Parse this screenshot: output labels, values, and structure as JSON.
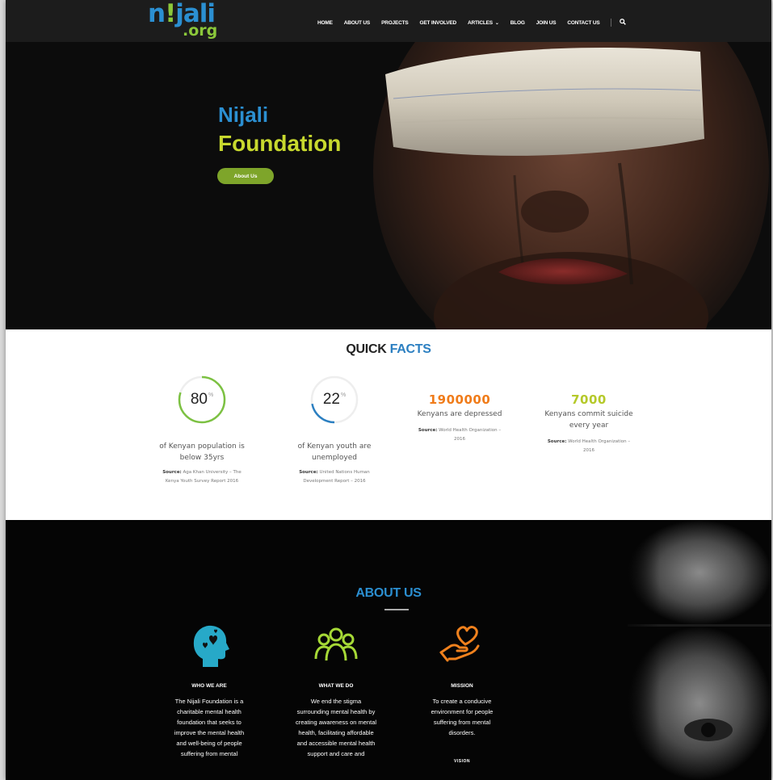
{
  "header": {
    "logo_line1": "n",
    "logo_dot": "!",
    "logo_line1b": "jali",
    "logo_line2": ".org",
    "nav": [
      "HOME",
      "ABOUT US",
      "PROJECTS",
      "GET INVOLVED",
      "ARTICLES",
      "BLOG",
      "JOIN US",
      "CONTACT US"
    ],
    "articles_caret": "⌄",
    "search_icon": "search-icon",
    "colors": {
      "brand_blue": "#2b8fd1",
      "brand_green": "#8bc83a"
    }
  },
  "hero": {
    "title_line1": "Nijali",
    "title_line2": "Foundation",
    "button_label": "About Us"
  },
  "quick_facts": {
    "heading_part1": "QUICK",
    "heading_part2": "FACTS",
    "stats": [
      {
        "value": "80",
        "suffix": "%",
        "percent": 80,
        "ring_color": "#7cc142",
        "description": [
          "of Kenyan population is",
          "below 35yrs"
        ],
        "source_label": "Source:",
        "source_line1": "Aga Khan University – The",
        "source_line2": "Kenya Youth Survey Report 2016"
      },
      {
        "value": "22",
        "suffix": "%",
        "percent": 22,
        "ring_color": "#2b7fc1",
        "description": [
          "of Kenyan youth are",
          "unemployed"
        ],
        "source_label": "Source:",
        "source_line1": "United Nations Human",
        "source_line2": "Development Report – 2016"
      },
      {
        "number": "1900000",
        "number_color": "#f07c1a",
        "description": [
          "Kenyans are depressed"
        ],
        "source_label": "Source:",
        "source_line1": "World Health Organization –",
        "source_line2": "2016"
      },
      {
        "number": "7000",
        "number_color": "#b5c92a",
        "description": [
          "Kenyans commit suicide",
          "every year"
        ],
        "source_label": "Source:",
        "source_line1": "World Health Organization –",
        "source_line2": "2016"
      }
    ]
  },
  "about": {
    "heading": "ABOUT US",
    "columns": [
      {
        "icon": "head-heart-icon",
        "title": "WHO WE ARE",
        "text": [
          "The Nijali Foundation is a",
          "charitable mental health",
          "foundation that seeks to",
          "improve the mental health",
          "and well-being of people",
          "suffering from mental"
        ]
      },
      {
        "icon": "people-group-icon",
        "title": "WHAT WE DO",
        "text": [
          "We end the stigma",
          "surrounding mental health by",
          "creating awareness on mental",
          "health, facilitating affordable",
          "and accessible mental health",
          "support and care and"
        ]
      },
      {
        "icon": "hand-heart-icon",
        "title": "MISSION",
        "text": [
          "To create a conducive",
          "environment for people",
          "suffering from mental",
          "disorders."
        ],
        "subtitle": "VISION"
      }
    ]
  }
}
